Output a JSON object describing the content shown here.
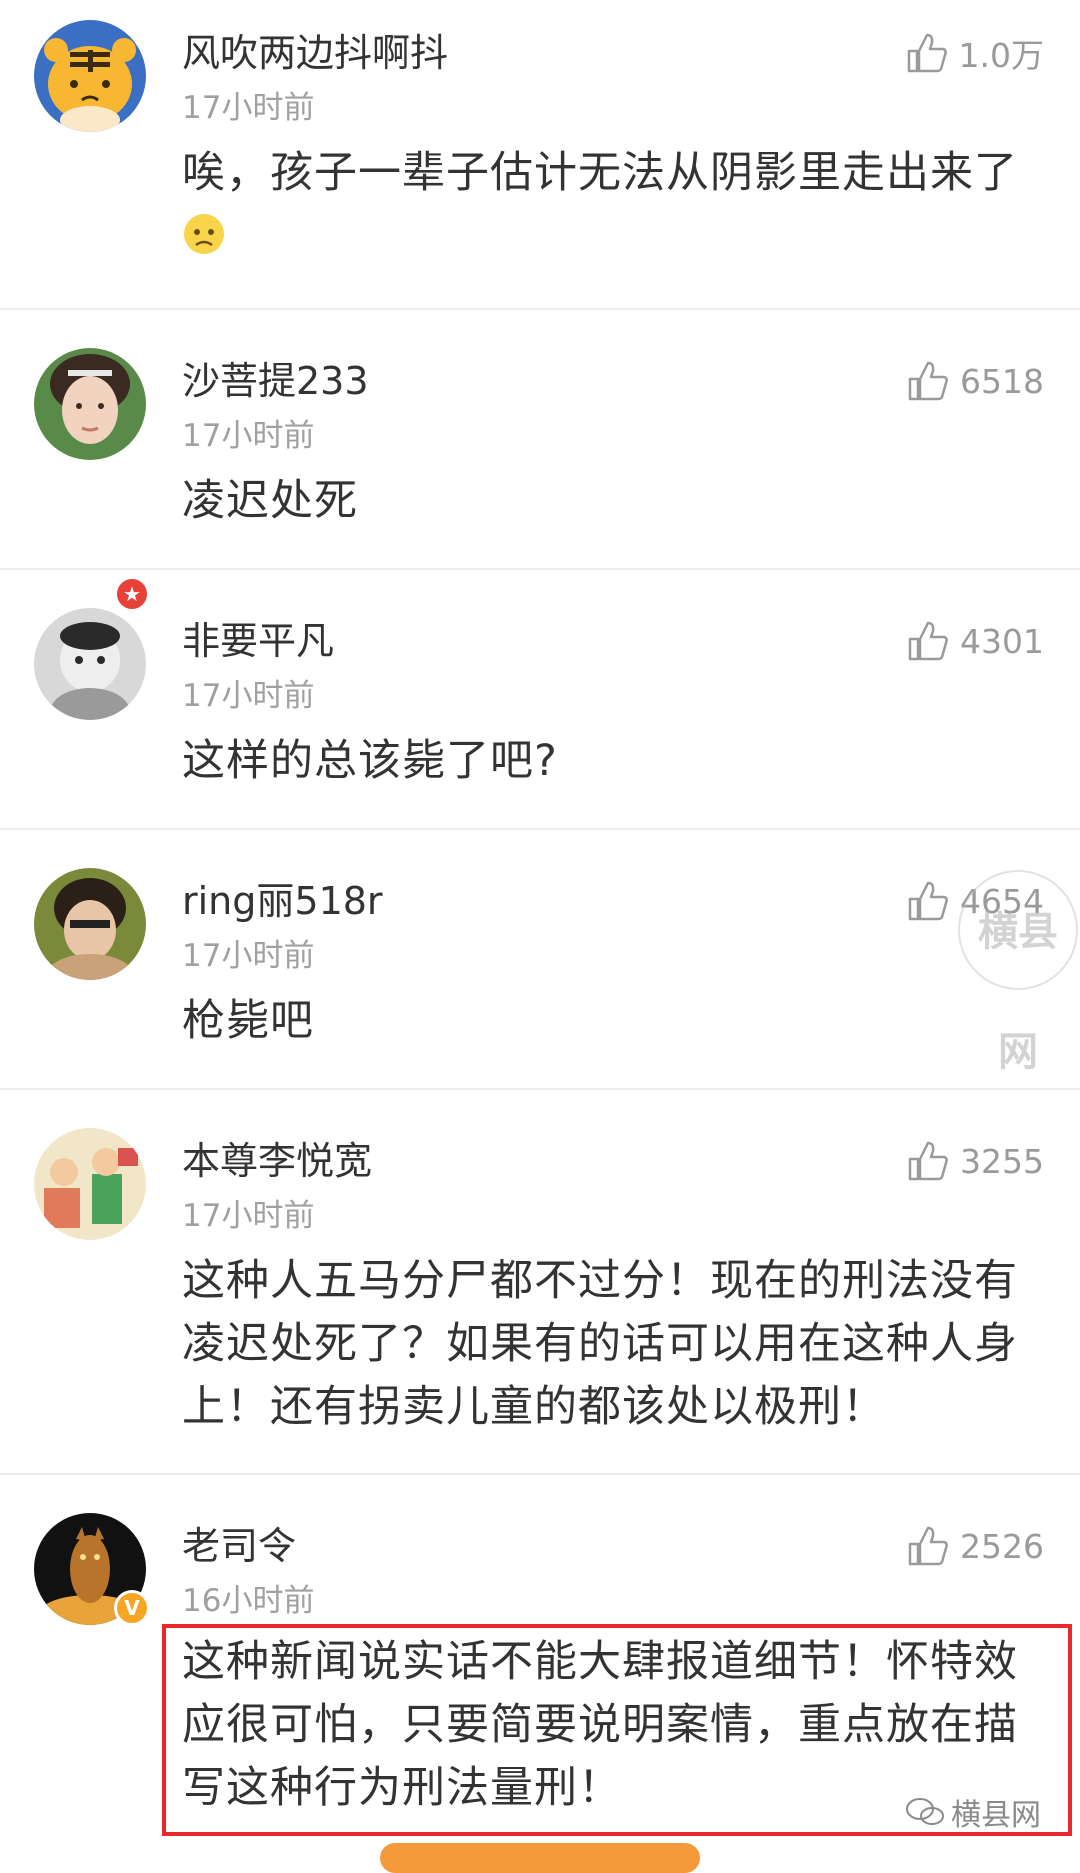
{
  "like_icon": "thumbs-up-icon",
  "colors": {
    "highlight_border": "#e8282a",
    "username": "#333333",
    "timestamp": "#a0a0a0",
    "like_count": "#9a9a9a"
  },
  "comments": [
    {
      "username": "风吹两边抖啊抖",
      "time": "17小时前",
      "likes": "1.0万",
      "text": "唉，孩子一辈子估计无法从阴影里走出来了",
      "emoji": "sad-face-emoji"
    },
    {
      "username": "沙菩提233",
      "time": "17小时前",
      "likes": "6518",
      "text": "凌迟处死"
    },
    {
      "username": "非要平凡",
      "time": "17小时前",
      "likes": "4301",
      "text": "这样的总该毙了吧?"
    },
    {
      "username": "ring丽518r",
      "time": "17小时前",
      "likes": "4654",
      "text": "枪毙吧"
    },
    {
      "username": "本尊李悦宽",
      "time": "17小时前",
      "likes": "3255",
      "text": "这种人五马分尸都不过分！现在的刑法没有凌迟处死了？如果有的话可以用在这种人身上！还有拐卖儿童的都该处以极刑！"
    },
    {
      "username": "老司令",
      "time": "16小时前",
      "likes": "2526",
      "text": "这种新闻说实话不能大肆报道细节！怀特效应很可怕，只要简要说明案情，重点放在描写这种行为刑法量刑！"
    }
  ],
  "watermark": {
    "stamp_text": "横县网",
    "brand_text": "横县网"
  }
}
